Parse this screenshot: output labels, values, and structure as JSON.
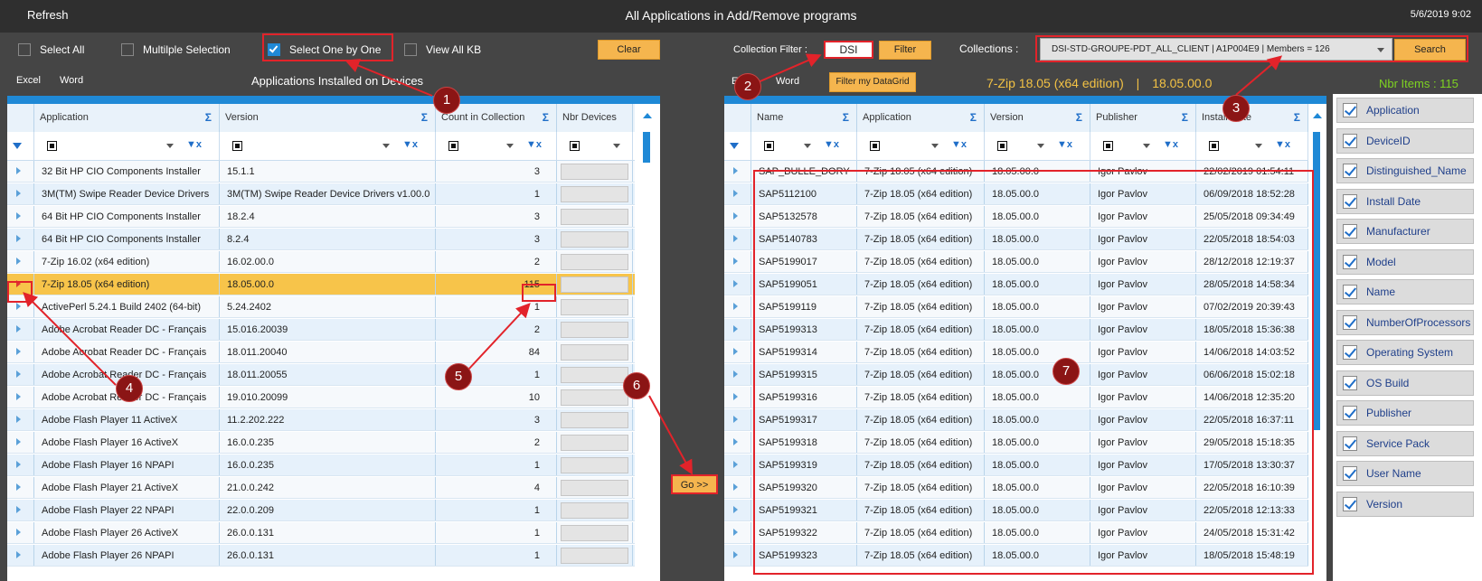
{
  "window": {
    "refresh": "Refresh",
    "title": "All Applications in Add/Remove programs",
    "datetime": "5/6/2019 9:02"
  },
  "options": {
    "select_all": "Select All",
    "multiple_selection": "Multilple Selection",
    "select_one_by_one": "Select One by One",
    "view_all_kb": "View All KB",
    "clear": "Clear"
  },
  "collection_filter": {
    "label": "Collection Filter :",
    "value": "DSI",
    "filter_button": "Filter",
    "collections_label": "Collections :",
    "collection_value": "DSI-STD-GROUPE-PDT_ALL_CLIENT  |  A1P004E9  |  Members = 126",
    "search_button": "Search"
  },
  "left": {
    "excel": "Excel",
    "word": "Word",
    "heading": "Applications Installed on Devices",
    "columns": [
      "Application",
      "Version",
      "Count in Collection",
      "Nbr Devices"
    ],
    "rows": [
      {
        "app": "32 Bit HP CIO Components Installer",
        "ver": "15.1.1",
        "count": "3"
      },
      {
        "app": "3M(TM) Swipe Reader Device Drivers",
        "ver": "3M(TM) Swipe Reader Device Drivers v1.00.0",
        "count": "1"
      },
      {
        "app": "64 Bit HP CIO Components Installer",
        "ver": "18.2.4",
        "count": "3"
      },
      {
        "app": "64 Bit HP CIO Components Installer",
        "ver": "8.2.4",
        "count": "3"
      },
      {
        "app": "7-Zip 16.02 (x64 edition)",
        "ver": "16.02.00.0",
        "count": "2"
      },
      {
        "app": "7-Zip 18.05 (x64 edition)",
        "ver": "18.05.00.0",
        "count": "115"
      },
      {
        "app": "ActivePerl 5.24.1 Build 2402 (64-bit)",
        "ver": "5.24.2402",
        "count": "1"
      },
      {
        "app": "Adobe Acrobat Reader DC - Français",
        "ver": "15.016.20039",
        "count": "2"
      },
      {
        "app": "Adobe Acrobat Reader DC - Français",
        "ver": "18.011.20040",
        "count": "84"
      },
      {
        "app": "Adobe Acrobat Reader DC - Français",
        "ver": "18.011.20055",
        "count": "1"
      },
      {
        "app": "Adobe Acrobat Reader DC - Français",
        "ver": "19.010.20099",
        "count": "10"
      },
      {
        "app": "Adobe Flash Player 11 ActiveX",
        "ver": "11.2.202.222",
        "count": "3"
      },
      {
        "app": "Adobe Flash Player 16 ActiveX",
        "ver": "16.0.0.235",
        "count": "2"
      },
      {
        "app": "Adobe Flash Player 16 NPAPI",
        "ver": "16.0.0.235",
        "count": "1"
      },
      {
        "app": "Adobe Flash Player 21 ActiveX",
        "ver": "21.0.0.242",
        "count": "4"
      },
      {
        "app": "Adobe Flash Player 22 NPAPI",
        "ver": "22.0.0.209",
        "count": "1"
      },
      {
        "app": "Adobe Flash Player 26 ActiveX",
        "ver": "26.0.0.131",
        "count": "1"
      },
      {
        "app": "Adobe Flash Player 26 NPAPI",
        "ver": "26.0.0.131",
        "count": "1"
      }
    ]
  },
  "go_button": "Go >>",
  "right": {
    "excel": "Excel",
    "word": "Word",
    "filter_datagrid": "Filter my DataGrid",
    "selected_app": "7-Zip 18.05 (x64 edition)",
    "sep": "|",
    "selected_ver": "18.05.00.0",
    "nbr_items": "Nbr Items : 115",
    "columns": [
      "Name",
      "Application",
      "Version",
      "Publisher",
      "Install Date"
    ],
    "rows": [
      {
        "name": "SAP_BULLE_DORY",
        "date": "22/02/2019 01:54:11"
      },
      {
        "name": "SAP5112100",
        "date": "06/09/2018 18:52:28"
      },
      {
        "name": "SAP5132578",
        "date": "25/05/2018 09:34:49"
      },
      {
        "name": "SAP5140783",
        "date": "22/05/2018 18:54:03"
      },
      {
        "name": "SAP5199017",
        "date": "28/12/2018 12:19:37"
      },
      {
        "name": "SAP5199051",
        "date": "28/05/2018 14:58:34"
      },
      {
        "name": "SAP5199119",
        "date": "07/02/2019 20:39:43"
      },
      {
        "name": "SAP5199313",
        "date": "18/05/2018 15:36:38"
      },
      {
        "name": "SAP5199314",
        "date": "14/06/2018 14:03:52"
      },
      {
        "name": "SAP5199315",
        "date": "06/06/2018 15:02:18"
      },
      {
        "name": "SAP5199316",
        "date": "14/06/2018 12:35:20"
      },
      {
        "name": "SAP5199317",
        "date": "22/05/2018 16:37:11"
      },
      {
        "name": "SAP5199318",
        "date": "29/05/2018 15:18:35"
      },
      {
        "name": "SAP5199319",
        "date": "17/05/2018 13:30:37"
      },
      {
        "name": "SAP5199320",
        "date": "22/05/2018 16:10:39"
      },
      {
        "name": "SAP5199321",
        "date": "22/05/2018 12:13:33"
      },
      {
        "name": "SAP5199322",
        "date": "24/05/2018 15:31:42"
      },
      {
        "name": "SAP5199323",
        "date": "18/05/2018 15:48:19"
      }
    ],
    "row_app": "7-Zip 18.05 (x64 edition)",
    "row_ver": "18.05.00.0",
    "row_pub": "Igor Pavlov"
  },
  "column_chooser": [
    "Application",
    "DeviceID",
    "Distinguished_Name",
    "Install Date",
    "Manufacturer",
    "Model",
    "Name",
    "NumberOfProcessors",
    "Operating System",
    "OS Build",
    "Publisher",
    "Service Pack",
    "User Name",
    "Version"
  ],
  "markers": [
    "1",
    "2",
    "3",
    "4",
    "5",
    "6",
    "7"
  ],
  "colors": {
    "accent_blue": "#1f89d6",
    "orange": "#f5b54e",
    "selected_row": "#f7c44a",
    "annotation_red": "#e2232a",
    "green_text": "#7ed321"
  }
}
